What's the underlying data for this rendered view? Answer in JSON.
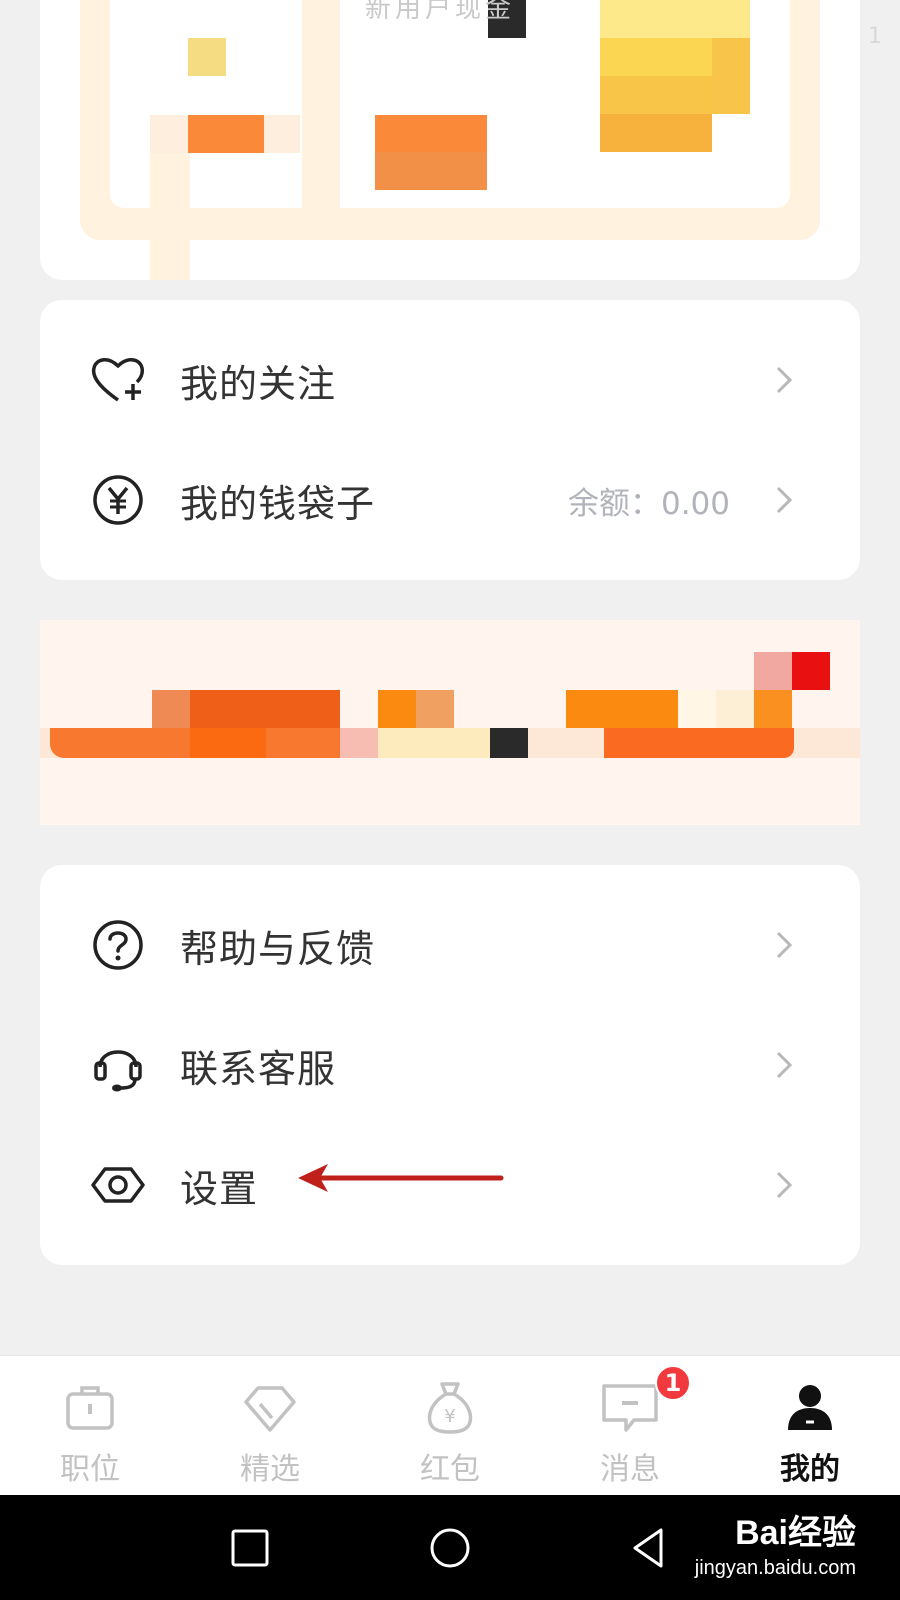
{
  "promo": {
    "title_partial": "新用户现金",
    "corner_digit": "1"
  },
  "menu_card_1": {
    "items": [
      {
        "label": "我的关注",
        "icon": "heart-plus-icon"
      },
      {
        "label": "我的钱袋子",
        "icon": "yuan-circle-icon",
        "value": "余额：0.00"
      }
    ]
  },
  "menu_card_2": {
    "items": [
      {
        "label": "帮助与反馈",
        "icon": "question-circle-icon"
      },
      {
        "label": "联系客服",
        "icon": "headset-icon"
      },
      {
        "label": "设置",
        "icon": "settings-hexagon-icon"
      }
    ]
  },
  "tabbar": {
    "tabs": [
      {
        "label": "职位",
        "icon": "briefcase-icon",
        "active": false
      },
      {
        "label": "精选",
        "icon": "diamond-icon",
        "active": false
      },
      {
        "label": "红包",
        "icon": "money-bag-icon",
        "active": false
      },
      {
        "label": "消息",
        "icon": "chat-icon",
        "active": false
      },
      {
        "label": "我的",
        "icon": "user-icon",
        "active": true
      }
    ],
    "messages_badge": "1"
  },
  "watermark": {
    "logo": "Bai经验",
    "url": "jingyan.baidu.com"
  },
  "colors": {
    "background": "#f0f0f0",
    "card": "#ffffff",
    "text_primary": "#333333",
    "text_muted": "#b0b4ba",
    "tab_inactive": "#c2c2c2",
    "badge": "#f2393d",
    "annotation_arrow": "#c0201a"
  }
}
